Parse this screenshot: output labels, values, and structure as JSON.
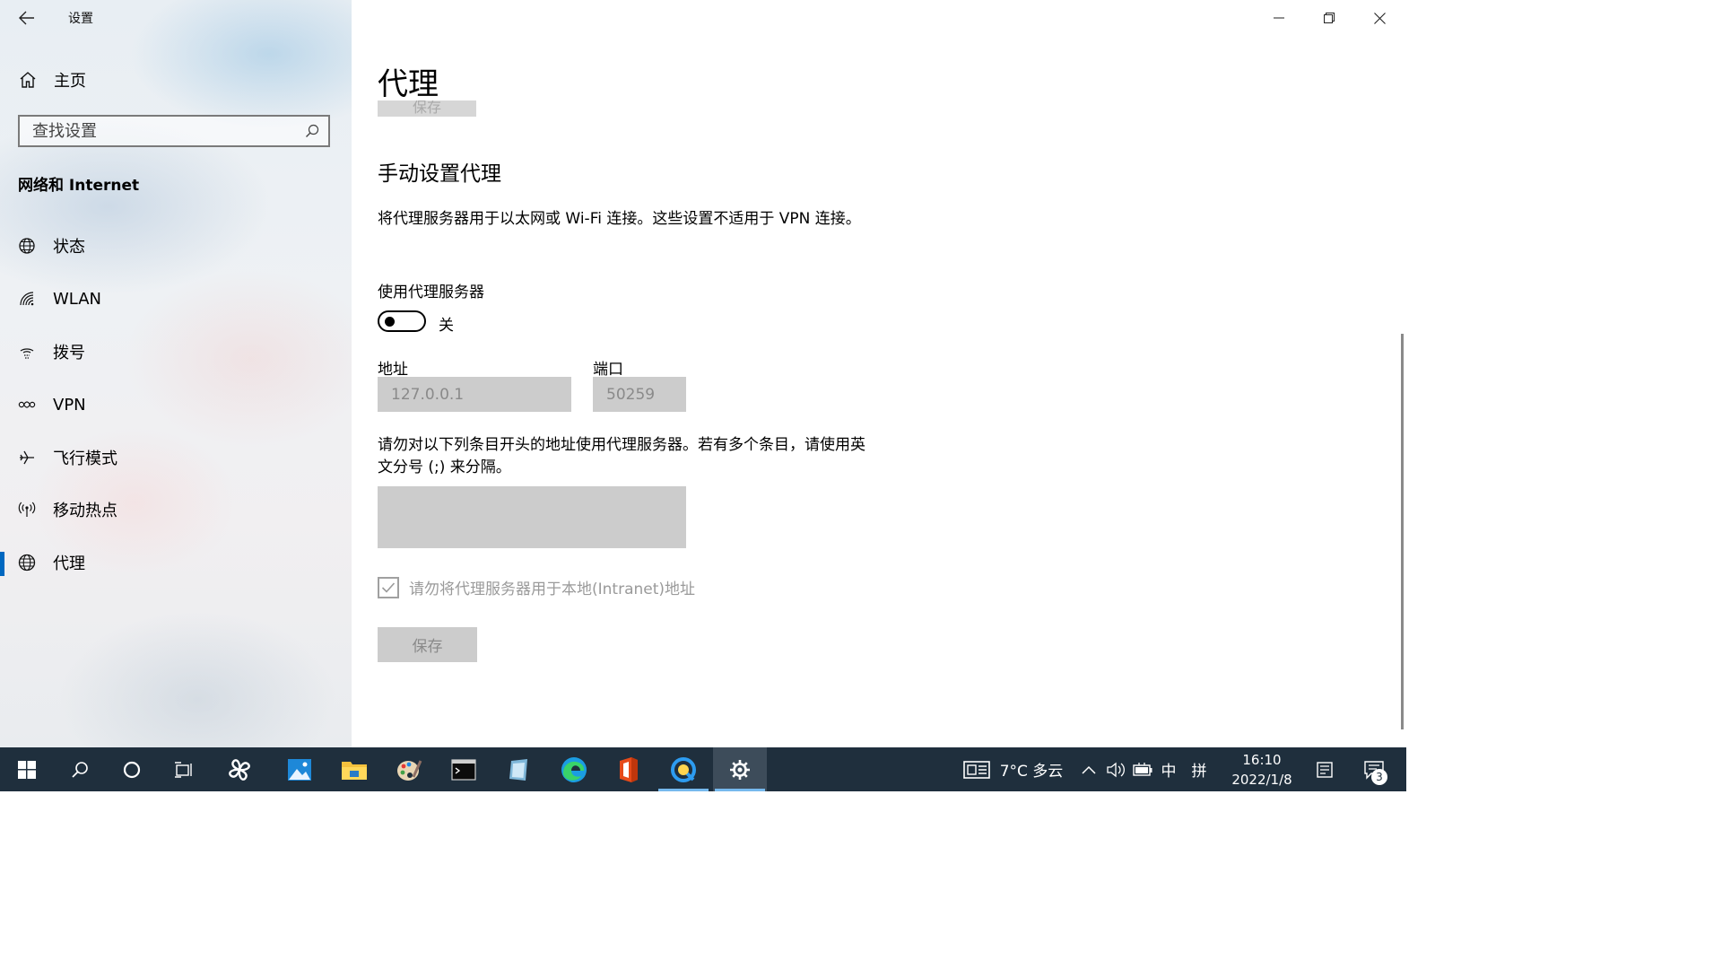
{
  "window": {
    "title": "设置",
    "controls": {
      "minimize": "minimize-icon",
      "maximize": "restore-icon",
      "close": "close-icon"
    }
  },
  "sidebar": {
    "home_label": "主页",
    "search_placeholder": "查找设置",
    "section_title": "网络和 Internet",
    "items": [
      {
        "label": "状态",
        "icon": "globe-status-icon"
      },
      {
        "label": "WLAN",
        "icon": "wifi-icon"
      },
      {
        "label": "拨号",
        "icon": "dialup-icon"
      },
      {
        "label": "VPN",
        "icon": "vpn-icon"
      },
      {
        "label": "飞行模式",
        "icon": "airplane-icon"
      },
      {
        "label": "移动热点",
        "icon": "hotspot-icon"
      },
      {
        "label": "代理",
        "icon": "globe-icon",
        "active": true
      }
    ]
  },
  "main": {
    "page_title": "代理",
    "clipped_button_label": "保存",
    "manual_heading": "手动设置代理",
    "manual_desc": "将代理服务器用于以太网或 Wi-Fi 连接。这些设置不适用于 VPN 连接。",
    "use_proxy_label": "使用代理服务器",
    "toggle_state": "关",
    "toggle_on": false,
    "address_label": "地址",
    "address_value": "127.0.0.1",
    "port_label": "端口",
    "port_value": "50259",
    "exceptions_desc": "请勿对以下列条目开头的地址使用代理服务器。若有多个条目，请使用英文分号 (;) 来分隔。",
    "exceptions_value": "",
    "bypass_local_label": "请勿将代理服务器用于本地(Intranet)地址",
    "bypass_local_checked": true,
    "save_label": "保存"
  },
  "taskbar": {
    "apps": [
      "start-icon",
      "search-icon",
      "cortana-icon",
      "task-view-icon",
      "pinwheel-app-icon",
      "photos-icon",
      "file-explorer-icon",
      "paint-icon",
      "terminal-icon",
      "notes-icon",
      "edge-icon",
      "office-icon",
      "browser-q-icon",
      "settings-icon"
    ],
    "active_app": "settings-icon",
    "weather": "7°C 多云",
    "input_method": "中",
    "input_mode": "拼",
    "time": "16:10",
    "date": "2022/1/8",
    "notification_count": "3"
  },
  "colors": {
    "accent": "#0067c0",
    "taskbar": "#1f2f3d",
    "disabled_field": "#cccccc"
  }
}
